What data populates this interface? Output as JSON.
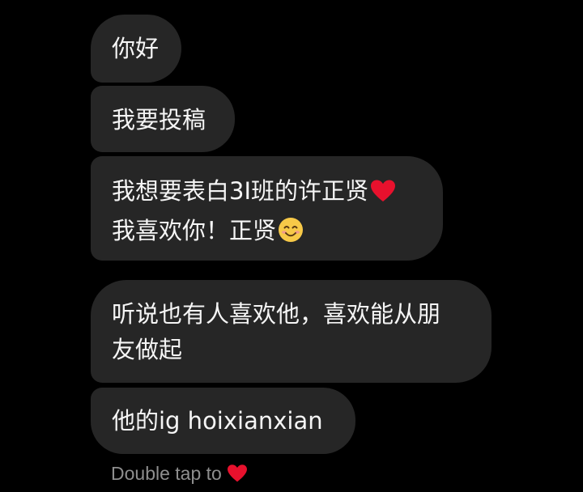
{
  "messages": [
    {
      "lines": [
        "你好"
      ]
    },
    {
      "lines": [
        "我要投稿"
      ]
    },
    {
      "lines": [
        "我想要表白3I班的许正贤",
        "我喜欢你！正贤"
      ],
      "line1_emoji": "red-heart",
      "line2_emoji": "smiling-face"
    },
    {
      "lines": [
        "听说也有人喜欢他，喜欢能从朋",
        "友做起"
      ]
    },
    {
      "lines": [
        "他的ig hoixianxian"
      ]
    }
  ],
  "hint": {
    "text": "Double tap to",
    "emoji": "red-heart"
  },
  "colors": {
    "background": "#000000",
    "bubble": "#262626",
    "text": "#f5f5f5",
    "hint_text": "#8e8e8e",
    "heart": "#e8112d",
    "smile": "#f7c948"
  }
}
